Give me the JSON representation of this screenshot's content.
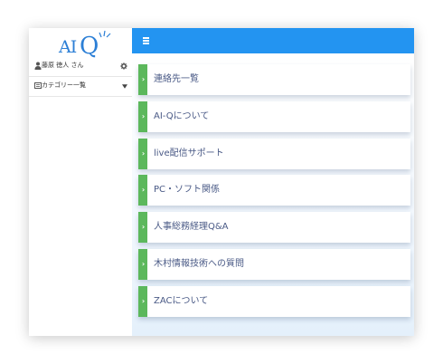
{
  "logo": {
    "text": "AI",
    "q": "Q"
  },
  "sidebar": {
    "user_name": "藤原 徳人 さん",
    "category_label": "カテゴリー一覧"
  },
  "menu_items": [
    {
      "label": "連絡先一覧"
    },
    {
      "label": "AI-Qについて"
    },
    {
      "label": "live配信サポート"
    },
    {
      "label": "PC・ソフト関係"
    },
    {
      "label": "人事総務経理Q&A"
    },
    {
      "label": "木村情報技術への質問"
    },
    {
      "label": "ZACについて"
    }
  ],
  "colors": {
    "header": "#2394f1",
    "accent_bar": "#5cb85c",
    "logo": "#2c7fd6",
    "item_text": "#4a5a86"
  }
}
